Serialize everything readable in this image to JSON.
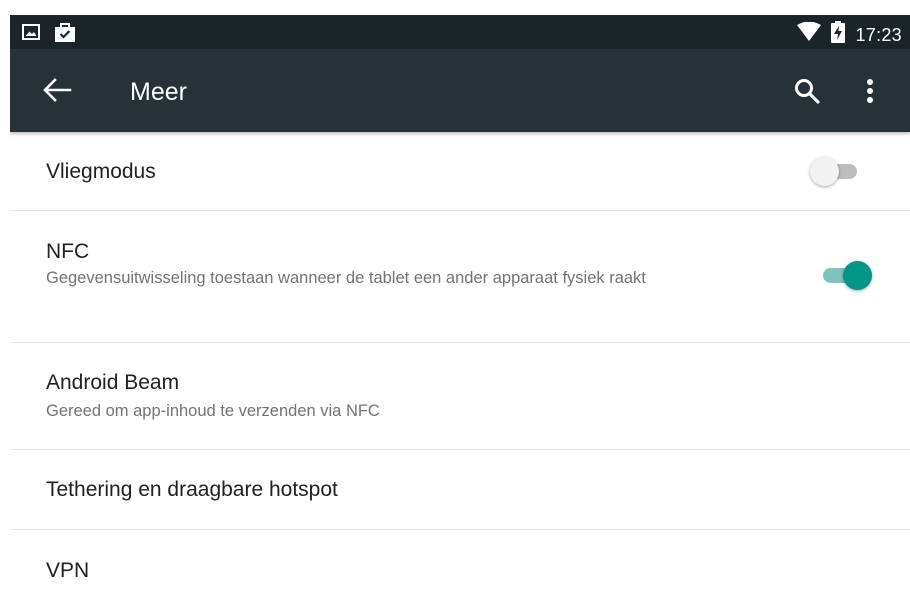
{
  "status_bar": {
    "time": "17:23",
    "icons": [
      "image-notification-icon",
      "shopping-bag-icon",
      "wifi-icon",
      "battery-charging-icon"
    ]
  },
  "app_bar": {
    "title": "Meer",
    "actions": [
      "back-arrow-icon",
      "search-icon",
      "more-vert-icon"
    ]
  },
  "settings": [
    {
      "title": "Vliegmodus",
      "toggle": {
        "checked": false
      }
    },
    {
      "title": "NFC",
      "summary": "Gegevensuitwisseling toestaan wanneer de tablet een ander apparaat fysiek raakt",
      "toggle": {
        "checked": true
      }
    },
    {
      "title": "Android Beam",
      "summary": "Gereed om app-inhoud te verzenden via NFC"
    },
    {
      "title": "Tethering en draagbare hotspot"
    },
    {
      "title": "VPN"
    }
  ],
  "colors": {
    "status_bar": "#1b2529",
    "app_bar": "#263238",
    "accent": "#009688",
    "accent_track": "#7fc4bc",
    "divider": "#e2e2e2",
    "primary_text": "#212121",
    "secondary_text": "#737373"
  }
}
